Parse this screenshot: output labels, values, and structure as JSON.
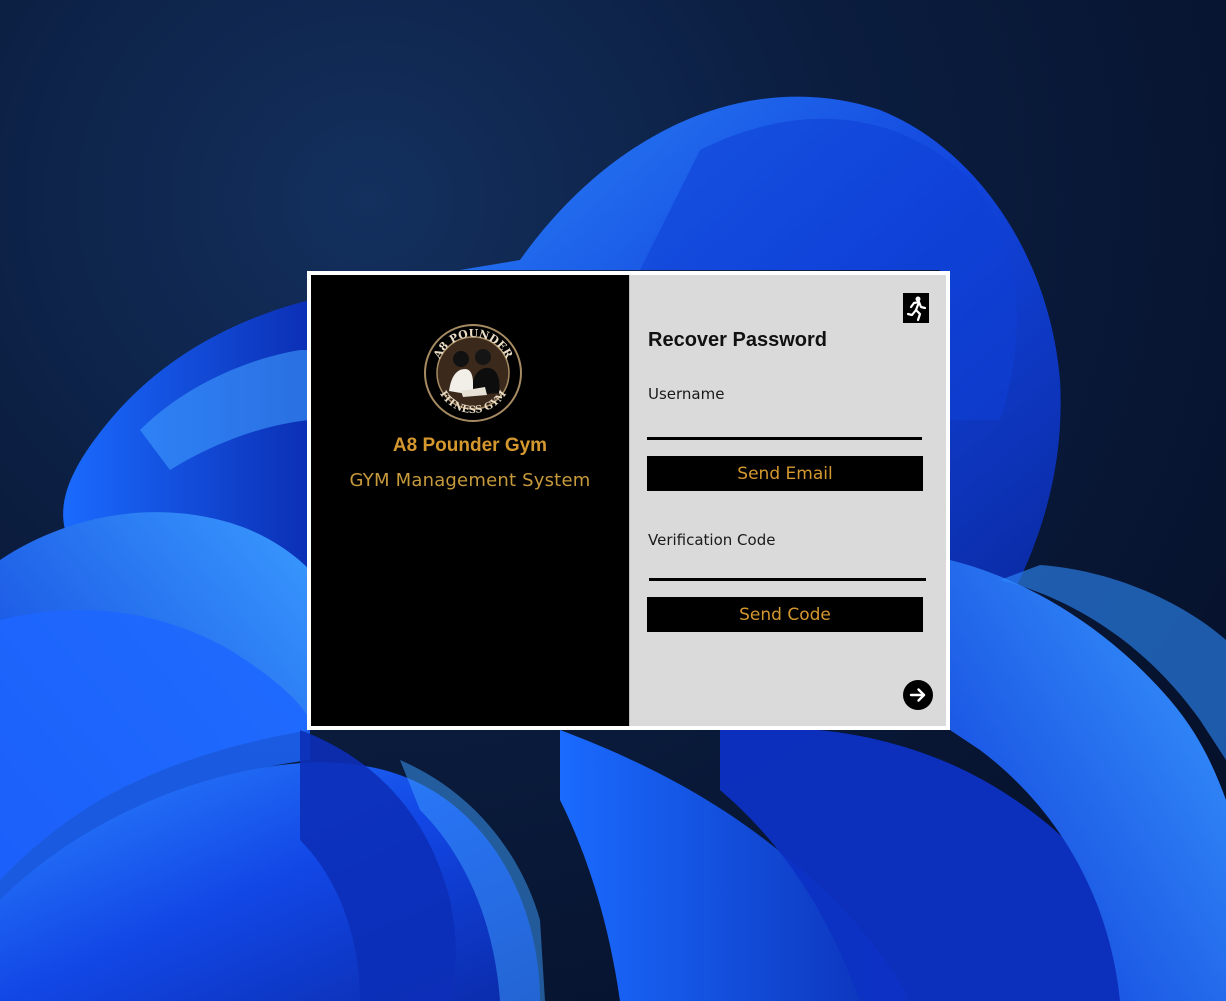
{
  "brand": {
    "name": "A8 Pounder Gym",
    "subtitle": "GYM Management System",
    "logo_text_top": "A8 POUNDER",
    "logo_text_bottom": "FITNESS GYM"
  },
  "form": {
    "title": "Recover Password",
    "username_label": "Username",
    "username_value": "",
    "send_email_label": "Send Email",
    "verification_label": "Verification Code",
    "verification_value": "",
    "send_code_label": "Send Code"
  },
  "icons": {
    "exit": "exit-running-icon",
    "next": "arrow-right-circle-icon",
    "logo": "gym-logo-emblem"
  },
  "colors": {
    "accent_gold": "#d4982f",
    "panel_dark": "#000000",
    "panel_light": "#dadada",
    "desktop_bg": "#0b1d3f",
    "wallpaper_blue": "#1f5fff"
  }
}
